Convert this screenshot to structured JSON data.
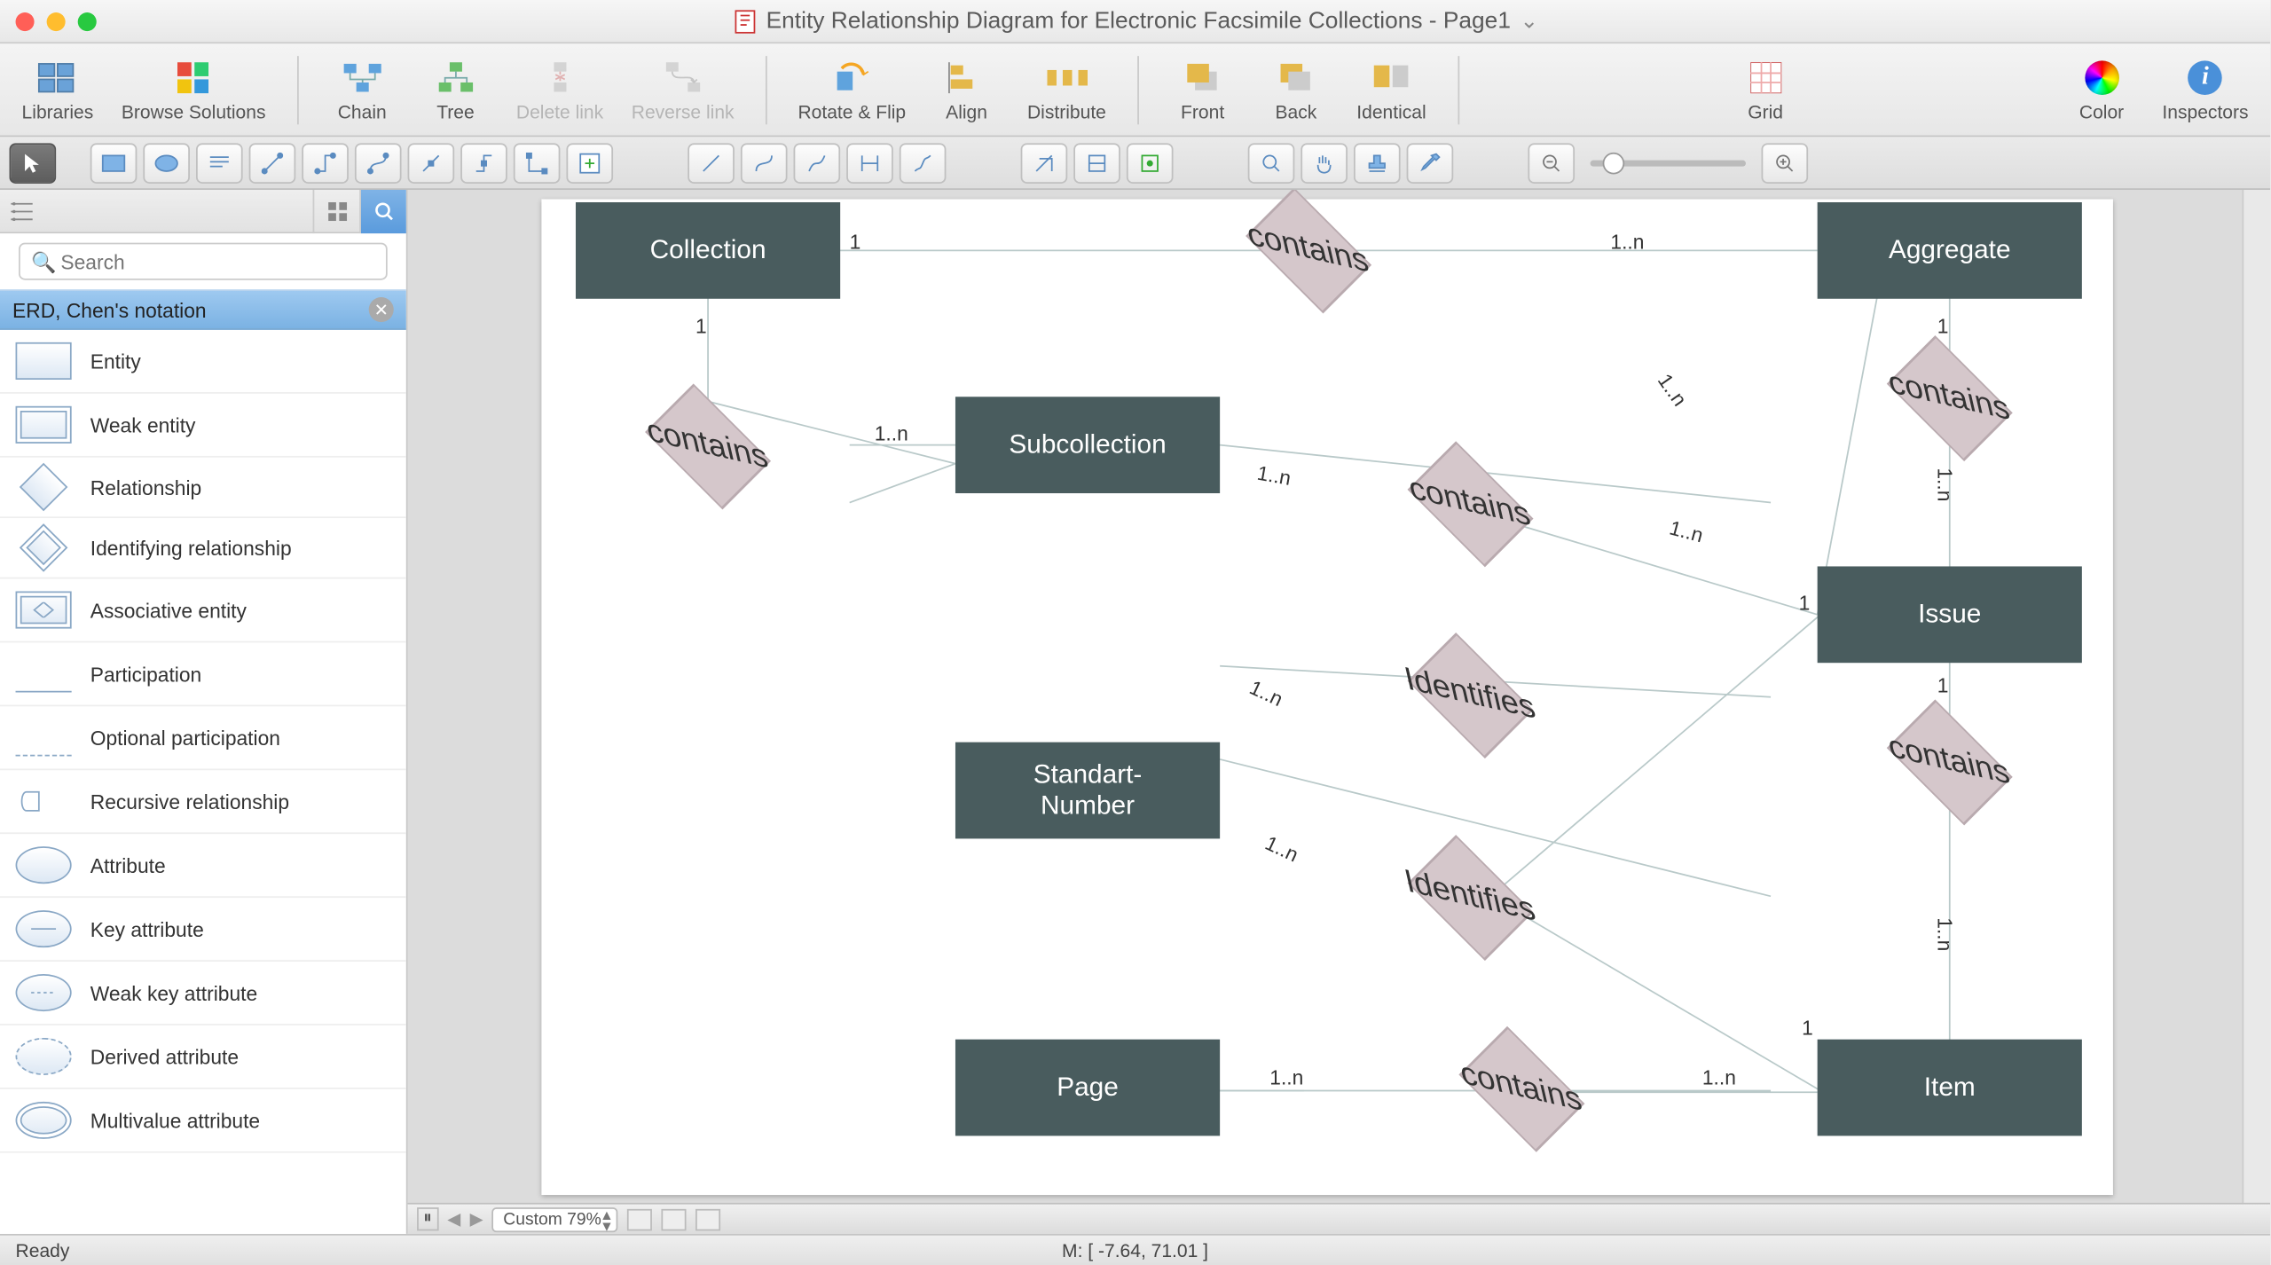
{
  "window": {
    "title": "Entity Relationship Diagram for Electronic Facsimile Collections - Page1"
  },
  "toolbar": {
    "libraries": "Libraries",
    "browse_solutions": "Browse Solutions",
    "chain": "Chain",
    "tree": "Tree",
    "delete_link": "Delete link",
    "reverse_link": "Reverse link",
    "rotate_flip": "Rotate & Flip",
    "align": "Align",
    "distribute": "Distribute",
    "front": "Front",
    "back": "Back",
    "identical": "Identical",
    "grid": "Grid",
    "color": "Color",
    "inspectors": "Inspectors"
  },
  "search": {
    "placeholder": "Search"
  },
  "library": {
    "header": "ERD, Chen's notation",
    "items": [
      "Entity",
      "Weak entity",
      "Relationship",
      "Identifying relationship",
      "Associative entity",
      "Participation",
      "Optional participation",
      "Recursive relationship",
      "Attribute",
      "Key attribute",
      "Weak key attribute",
      "Derived attribute",
      "Multivalue attribute"
    ]
  },
  "diagram": {
    "entities": {
      "collection": "Collection",
      "aggregate": "Aggregate",
      "subcollection": "Subcollection",
      "issue": "Issue",
      "standart_number": "Standart-\nNumber",
      "page": "Page",
      "item": "Item"
    },
    "relationships": {
      "contains": "contains",
      "identifies": "Identifies"
    },
    "cardinalities": {
      "one": "1",
      "one_n": "1..n"
    }
  },
  "footer": {
    "zoom_label": "Custom 79%"
  },
  "statusbar": {
    "ready": "Ready",
    "mouse": "M: [ -7.64, 71.01 ]"
  }
}
